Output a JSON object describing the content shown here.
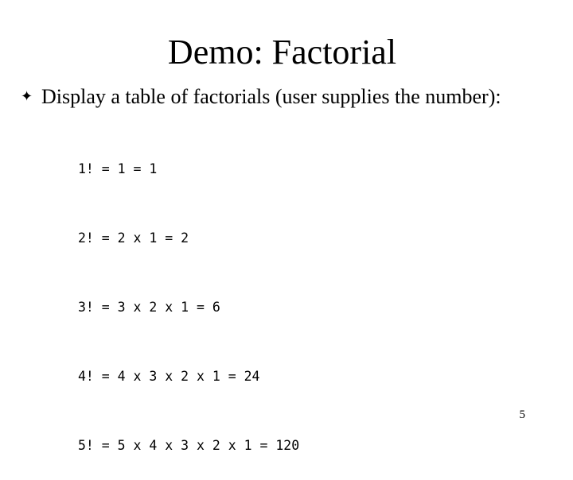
{
  "slide": {
    "title": "Demo: Factorial",
    "bullet": {
      "icon": "four-pointed-star-bullet-icon",
      "glyph": "✦",
      "text": "Display a table of factorials (user supplies the number):"
    },
    "code_lines": [
      "1! = 1 = 1",
      "2! = 2 x 1 = 2",
      "3! = 3 x 2 x 1 = 6",
      "4! = 4 x 3 x 2 x 1 = 24",
      "5! = 5 x 4 x 3 x 2 x 1 = 120"
    ],
    "page_number": "5"
  }
}
